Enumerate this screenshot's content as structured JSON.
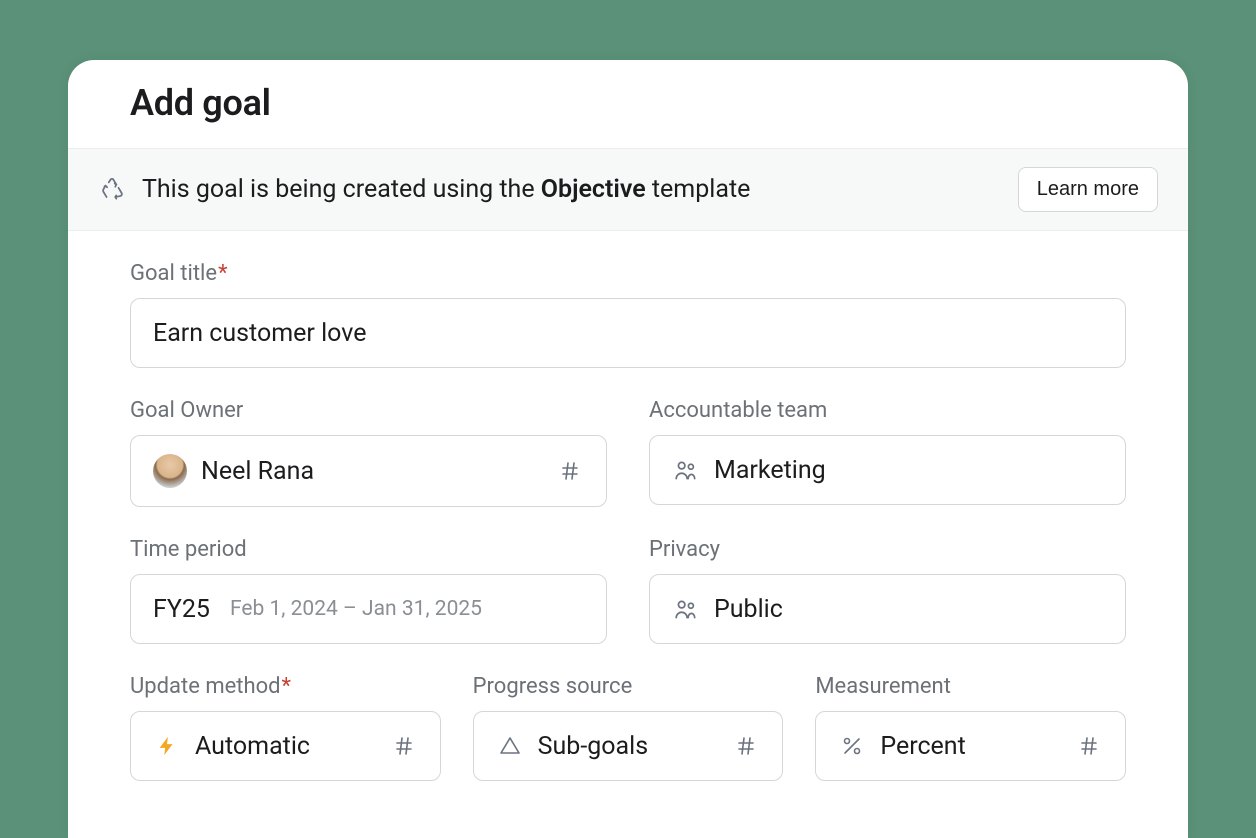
{
  "modal": {
    "title": "Add goal"
  },
  "banner": {
    "text_before": "This goal is being created using the ",
    "template_name": "Objective",
    "text_after": " template",
    "learn_more": "Learn more"
  },
  "fields": {
    "goal_title": {
      "label": "Goal title",
      "required": "*",
      "value": "Earn customer love"
    },
    "goal_owner": {
      "label": "Goal Owner",
      "value": "Neel Rana"
    },
    "accountable_team": {
      "label": "Accountable team",
      "value": "Marketing"
    },
    "time_period": {
      "label": "Time period",
      "value": "FY25",
      "range": "Feb 1, 2024 – Jan 31, 2025"
    },
    "privacy": {
      "label": "Privacy",
      "value": "Public"
    },
    "update_method": {
      "label": "Update method",
      "required": "*",
      "value": "Automatic"
    },
    "progress_source": {
      "label": "Progress source",
      "value": "Sub-goals"
    },
    "measurement": {
      "label": "Measurement",
      "value": "Percent"
    }
  }
}
